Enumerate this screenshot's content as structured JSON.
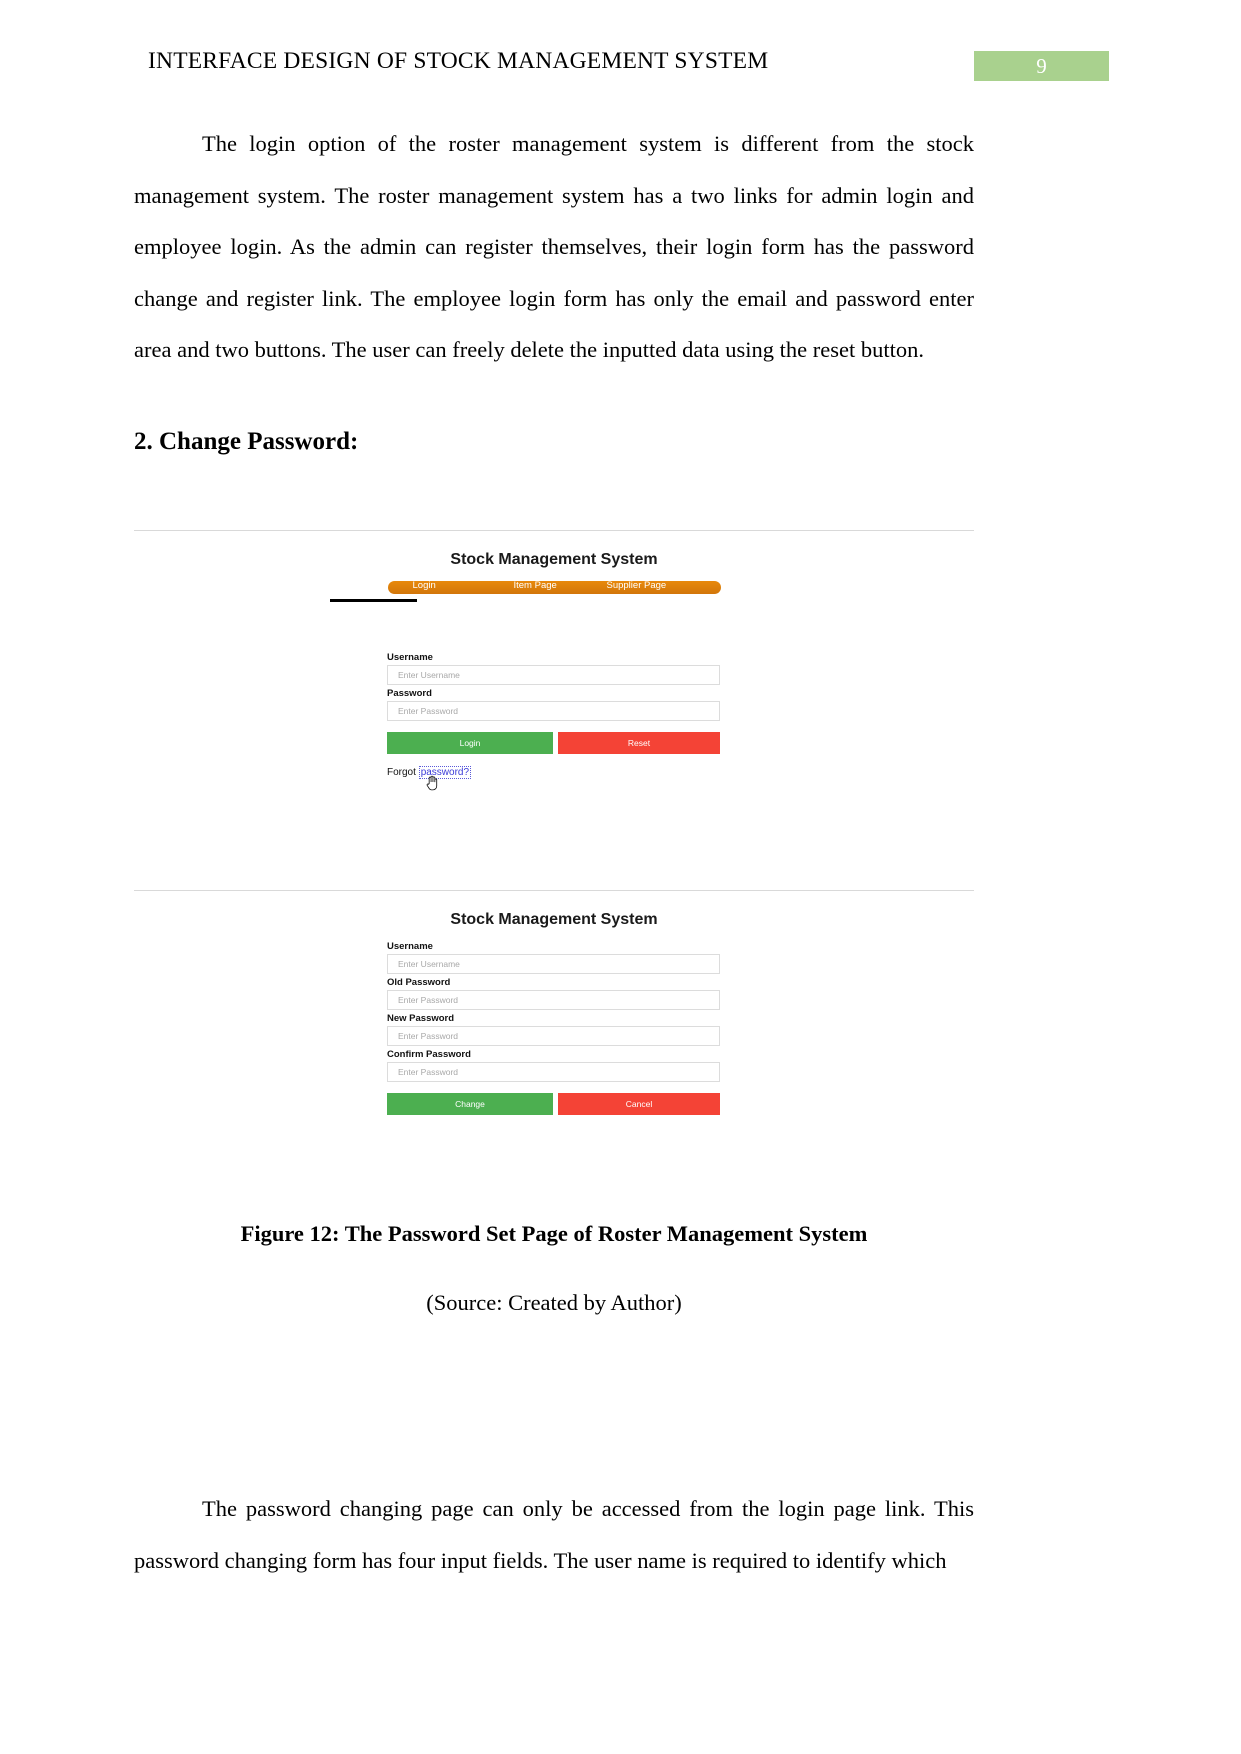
{
  "header": {
    "title": "INTERFACE DESIGN OF STOCK MANAGEMENT SYSTEM",
    "page_number": "9",
    "badge_color": "#a9d18e"
  },
  "body": {
    "paragraph_1": "The login option of the roster management system is different from the stock management system. The roster management system has a two links for admin login and employee login. As the admin can register themselves, their login form has the password change and register link. The employee login form has only the email and password enter area and two buttons. The user can freely delete the inputted data using the reset button.",
    "section_heading": "2. Change Password:",
    "paragraph_2": "The password changing page can only be accessed from the login page link. This password changing form has four input fields. The user name is required to identify which"
  },
  "figure": {
    "caption": "Figure 12: The Password Set Page of Roster Management System",
    "source": "(Source: Created by Author)"
  },
  "screenshot_login": {
    "app_title": "Stock Management System",
    "nav": {
      "items": [
        {
          "label": "Login",
          "active": true
        },
        {
          "label": "Item Page",
          "active": false
        },
        {
          "label": "Supplier Page",
          "active": false
        }
      ],
      "bar_color": "#e0810a"
    },
    "fields": [
      {
        "label": "Username",
        "placeholder": "Enter Username",
        "value": ""
      },
      {
        "label": "Password",
        "placeholder": "Enter Password",
        "value": ""
      }
    ],
    "buttons": [
      {
        "label": "Login",
        "color": "#4caf50"
      },
      {
        "label": "Reset",
        "color": "#f44336"
      }
    ],
    "forgot_prefix": "Forgot ",
    "forgot_link": "password?"
  },
  "screenshot_change_password": {
    "app_title": "Stock Management System",
    "fields": [
      {
        "label": "Username",
        "placeholder": "Enter Username",
        "value": ""
      },
      {
        "label": "Old Password",
        "placeholder": "Enter Password",
        "value": ""
      },
      {
        "label": "New Password",
        "placeholder": "Enter Password",
        "value": ""
      },
      {
        "label": "Confirm Password",
        "placeholder": "Enter Password",
        "value": ""
      }
    ],
    "buttons": [
      {
        "label": "Change",
        "color": "#4caf50"
      },
      {
        "label": "Cancel",
        "color": "#f44336"
      }
    ]
  }
}
